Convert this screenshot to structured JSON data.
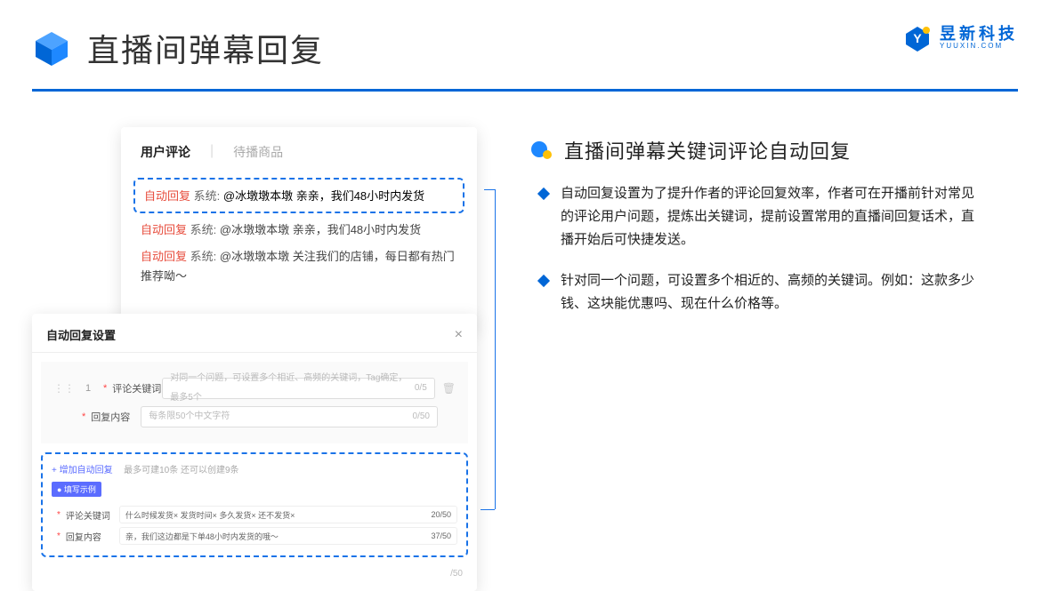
{
  "header": {
    "title": "直播间弹幕回复",
    "brand_cn": "昱新科技",
    "brand_en": "YUUXIN.COM"
  },
  "card1": {
    "tab_active": "用户评论",
    "tab_other": "待播商品",
    "highlight": "自动回复 系统: @冰墩墩本墩 亲亲，我们48小时内发货",
    "auto_tag": "自动回复",
    "sys_tag": "系统:",
    "line2_body": "@冰墩墩本墩 亲亲，我们48小时内发货",
    "line3_body": "@冰墩墩本墩 关注我们的店铺，每日都有热门推荐呦～"
  },
  "card2": {
    "title": "自动回复设置",
    "close": "×",
    "row_num": "1",
    "label1": "评论关键词",
    "ph1": "对同一个问题，可设置多个相近、高频的关键词，Tag确定，最多5个",
    "cnt1": "0/5",
    "label2": "回复内容",
    "ph2": "每条限50个中文字符",
    "cnt2": "0/50",
    "add_link": "+ 增加自动回复",
    "add_hint": "最多可建10条 还可以创建9条",
    "ex_badge": "● 填写示例",
    "ex_kw_label": "评论关键词",
    "ex_kw_tags": "什么时候发货× 发货时间× 多久发货× 还不发货×",
    "ex_kw_cnt": "20/50",
    "ex_reply_label": "回复内容",
    "ex_reply_val": "亲，我们这边都是下单48小时内发货的哦～",
    "ex_reply_cnt": "37/50",
    "trailing_cnt": "/50"
  },
  "right": {
    "section_title": "直播间弹幕关键词评论自动回复",
    "b1": "自动回复设置为了提升作者的评论回复效率，作者可在开播前针对常见的评论用户问题，提炼出关键词，提前设置常用的直播间回复话术，直播开始后可快捷发送。",
    "b2": "针对同一个问题，可设置多个相近的、高频的关键词。例如：这款多少钱、这块能优惠吗、现在什么价格等。"
  }
}
